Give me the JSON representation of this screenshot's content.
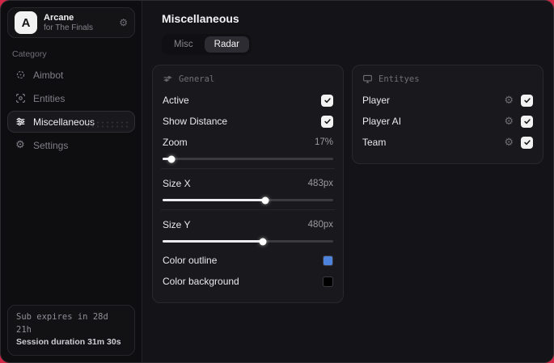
{
  "backdrop_color": "#d22746",
  "sidebar": {
    "brand": {
      "logo_letter": "A",
      "title": "Arcane",
      "subtitle": "for The Finals"
    },
    "category_label": "Category",
    "items": [
      {
        "label": "Aimbot",
        "icon": "crosshair-icon",
        "active": false
      },
      {
        "label": "Entities",
        "icon": "scan-icon",
        "active": false
      },
      {
        "label": "Miscellaneous",
        "icon": "sliders-icon",
        "active": true
      },
      {
        "label": "Settings",
        "icon": "gear-icon",
        "active": false
      }
    ],
    "subscription": {
      "line1": "Sub expires in 28d 21h",
      "line2": "Session duration 31m 30s"
    }
  },
  "main": {
    "title": "Miscellaneous",
    "tabs": [
      {
        "label": "Misc",
        "active": false
      },
      {
        "label": "Radar",
        "active": true
      }
    ],
    "general_panel": {
      "title": "General",
      "toggles": [
        {
          "label": "Active",
          "checked": true
        },
        {
          "label": "Show Distance",
          "checked": true
        }
      ],
      "sliders": [
        {
          "label": "Zoom",
          "value": "17%",
          "fill": "5%"
        },
        {
          "label": "Size X",
          "value": "483px",
          "fill": "60%"
        },
        {
          "label": "Size Y",
          "value": "480px",
          "fill": "59%"
        }
      ],
      "colors": [
        {
          "label": "Color outline",
          "swatch": "#4d82dd"
        },
        {
          "label": "Color background",
          "swatch": "#000000"
        }
      ]
    },
    "entities_panel": {
      "title": "Entityes",
      "rows": [
        {
          "label": "Player",
          "checked": true
        },
        {
          "label": "Player AI",
          "checked": true
        },
        {
          "label": "Team",
          "checked": true
        }
      ]
    }
  }
}
